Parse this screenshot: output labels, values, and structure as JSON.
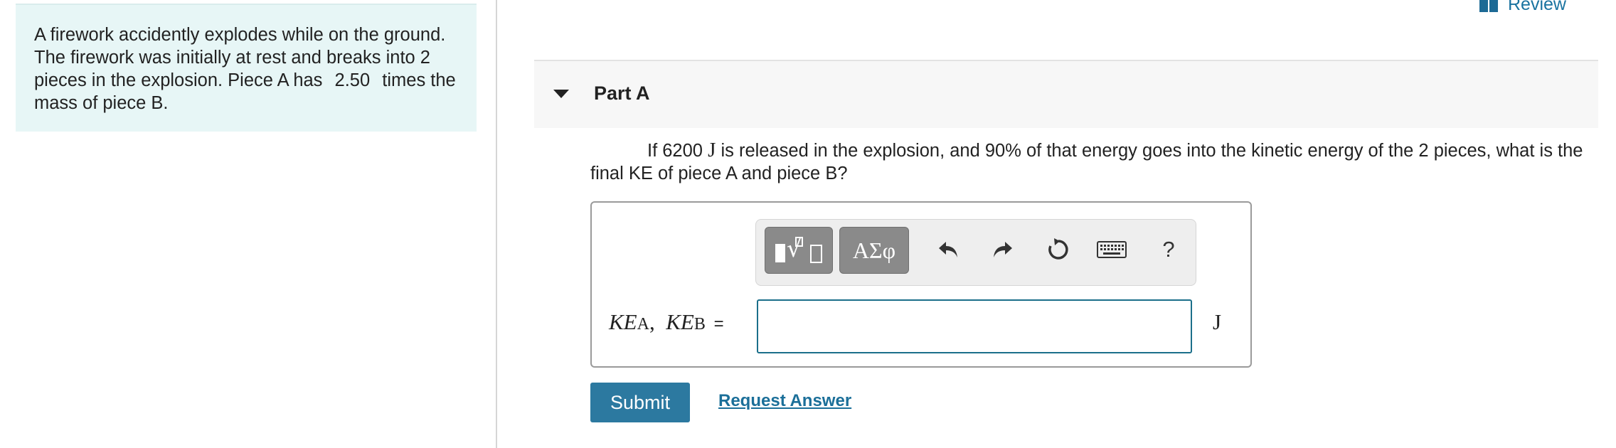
{
  "problem": {
    "text_before": "A firework accidently explodes while on the ground. The firework was initially at rest and breaks into 2 pieces in the explosion. Piece A has",
    "mass_ratio": "2.50",
    "text_after": "times the mass of piece B."
  },
  "header": {
    "review_label": "Review"
  },
  "part": {
    "title": "Part A"
  },
  "question": {
    "text_before": "If 6200",
    "unit_symbol": "J",
    "text_after": "is released in the explosion, and 90% of that energy goes into the kinetic energy of the 2 pieces, what is the final KE of piece A and piece B?"
  },
  "toolbar": {
    "greek_label": "ΑΣφ",
    "help_label": "?",
    "icons": [
      "templates-icon",
      "greek-letters-icon",
      "undo-icon",
      "redo-icon",
      "reset-icon",
      "keyboard-icon",
      "help-icon"
    ]
  },
  "answer": {
    "var1": "KE",
    "sub1": "A",
    "separator": ",",
    "var2": "KE",
    "sub2": "B",
    "equals": "=",
    "value": "",
    "placeholder": "",
    "unit": "J"
  },
  "actions": {
    "submit_label": "Submit",
    "request_label": "Request Answer"
  },
  "colors": {
    "problem_bg": "#e7f6f6",
    "accent": "#2c79a0",
    "input_border": "#1b6f8a",
    "link": "#1b6f99"
  }
}
